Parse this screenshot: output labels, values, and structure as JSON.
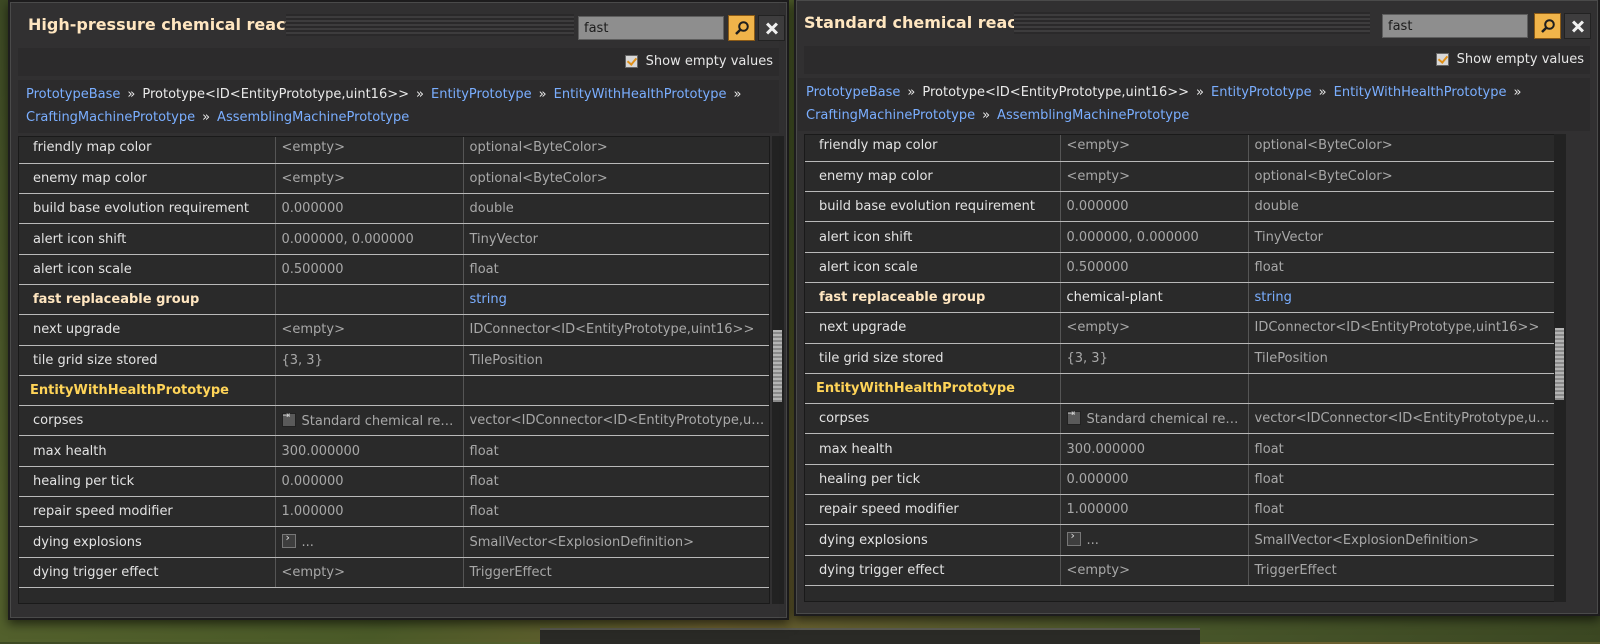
{
  "windows": [
    {
      "id": "left",
      "title": "High-pressure chemical reactor",
      "search": {
        "value": "fast"
      },
      "show_empty": {
        "label": "Show empty values",
        "checked": true
      },
      "breadcrumb_line1": [
        {
          "text": "PrototypeBase",
          "link": true
        },
        {
          "text": "Prototype<ID<EntityPrototype,uint16>>",
          "link": false
        },
        {
          "text": "EntityPrototype",
          "link": true
        },
        {
          "text": "EntityWithHealthPrototype",
          "link": true
        }
      ],
      "breadcrumb_line2": [
        {
          "text": "CraftingMachinePrototype",
          "link": true
        },
        {
          "text": "AssemblingMachinePrototype",
          "link": true
        }
      ],
      "rows": [
        {
          "name": "friendly map color",
          "value": "<empty>",
          "type": "optional<ByteColor>"
        },
        {
          "name": "enemy map color",
          "value": "<empty>",
          "type": "optional<ByteColor>"
        },
        {
          "name": "build base evolution requirement",
          "value": "0.000000",
          "type": "double"
        },
        {
          "name": "alert icon shift",
          "value": "0.000000, 0.000000",
          "type": "TinyVector"
        },
        {
          "name": "alert icon scale",
          "value": "0.500000",
          "type": "float"
        },
        {
          "name": "fast replaceable group",
          "value": "",
          "type": "string",
          "kind": "highlight"
        },
        {
          "name": "next upgrade",
          "value": "<empty>",
          "type": "IDConnector<ID<EntityPrototype,uint16>>"
        },
        {
          "name": "tile grid size stored",
          "value": "{3, 3}",
          "type": "TilePosition"
        },
        {
          "name": "EntityWithHealthPrototype",
          "value": "",
          "type": "",
          "kind": "section"
        },
        {
          "name": "corpses",
          "value": "Standard chemical reacto...",
          "type": "vector<IDConnector<ID<EntityPrototype,uint16>>>",
          "icon": "entity-icon"
        },
        {
          "name": "max health",
          "value": "300.000000",
          "type": "float"
        },
        {
          "name": "healing per tick",
          "value": "0.000000",
          "type": "float"
        },
        {
          "name": "repair speed modifier",
          "value": "1.000000",
          "type": "float"
        },
        {
          "name": "dying explosions",
          "value": "...",
          "type": "SmallVector<ExplosionDefinition>",
          "icon": "expand-icon"
        },
        {
          "name": "dying trigger effect",
          "value": "<empty>",
          "type": "TriggerEffect"
        }
      ],
      "scroll_fraction": 0.49
    },
    {
      "id": "right",
      "title": "Standard chemical reactor",
      "search": {
        "value": "fast"
      },
      "show_empty": {
        "label": "Show empty values",
        "checked": true
      },
      "breadcrumb_line1": [
        {
          "text": "PrototypeBase",
          "link": true
        },
        {
          "text": "Prototype<ID<EntityPrototype,uint16>>",
          "link": false
        },
        {
          "text": "EntityPrototype",
          "link": true
        },
        {
          "text": "EntityWithHealthPrototype",
          "link": true
        }
      ],
      "breadcrumb_line2": [
        {
          "text": "CraftingMachinePrototype",
          "link": true
        },
        {
          "text": "AssemblingMachinePrototype",
          "link": true
        }
      ],
      "rows": [
        {
          "name": "friendly map color",
          "value": "<empty>",
          "type": "optional<ByteColor>"
        },
        {
          "name": "enemy map color",
          "value": "<empty>",
          "type": "optional<ByteColor>"
        },
        {
          "name": "build base evolution requirement",
          "value": "0.000000",
          "type": "double"
        },
        {
          "name": "alert icon shift",
          "value": "0.000000, 0.000000",
          "type": "TinyVector"
        },
        {
          "name": "alert icon scale",
          "value": "0.500000",
          "type": "float"
        },
        {
          "name": "fast replaceable group",
          "value": "chemical-plant",
          "type": "string",
          "kind": "highlight"
        },
        {
          "name": "next upgrade",
          "value": "<empty>",
          "type": "IDConnector<ID<EntityPrototype,uint16>>"
        },
        {
          "name": "tile grid size stored",
          "value": "{3, 3}",
          "type": "TilePosition"
        },
        {
          "name": "EntityWithHealthPrototype",
          "value": "",
          "type": "",
          "kind": "section"
        },
        {
          "name": "corpses",
          "value": "Standard chemical reacto...",
          "type": "vector<IDConnector<ID<EntityPrototype,uint16>>>",
          "icon": "entity-icon"
        },
        {
          "name": "max health",
          "value": "300.000000",
          "type": "float"
        },
        {
          "name": "healing per tick",
          "value": "0.000000",
          "type": "float"
        },
        {
          "name": "repair speed modifier",
          "value": "1.000000",
          "type": "float"
        },
        {
          "name": "dying explosions",
          "value": "...",
          "type": "SmallVector<ExplosionDefinition>",
          "icon": "expand-icon"
        },
        {
          "name": "dying trigger effect",
          "value": "<empty>",
          "type": "TriggerEffect"
        }
      ],
      "scroll_fraction": 0.49
    }
  ]
}
